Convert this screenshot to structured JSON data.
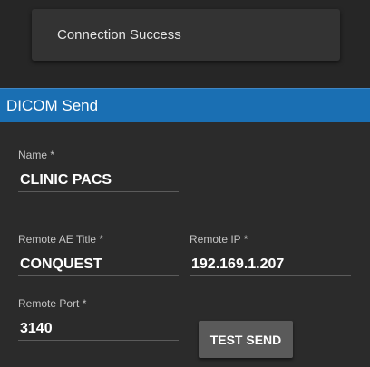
{
  "toast": {
    "message": "Connection Success"
  },
  "dialog": {
    "title": "DICOM Send"
  },
  "fields": {
    "name": {
      "label": "Name *",
      "value": "CLINIC PACS"
    },
    "remote_ae_title": {
      "label": "Remote AE Title *",
      "value": "CONQUEST"
    },
    "remote_ip": {
      "label": "Remote IP *",
      "value": "192.169.1.207"
    },
    "remote_port": {
      "label": "Remote Port *",
      "value": "3140"
    }
  },
  "buttons": {
    "test_send": "TEST SEND"
  },
  "colors": {
    "accent": "#1a6fb3",
    "background": "#2b2b2b",
    "button": "#5a5a5a"
  }
}
